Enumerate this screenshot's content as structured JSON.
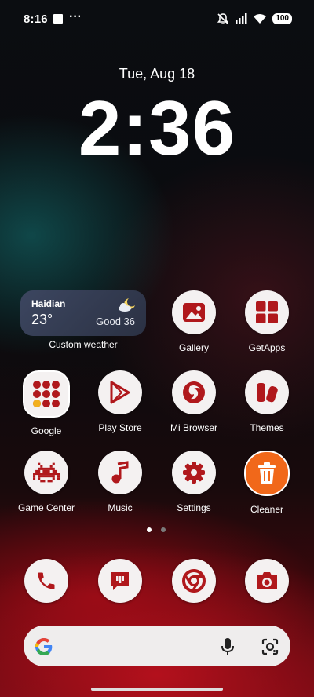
{
  "status_bar": {
    "time": "8:16",
    "dots": "···",
    "battery": "100"
  },
  "lock": {
    "date": "Tue, Aug 18",
    "time": "2:36"
  },
  "weather": {
    "city": "Haidian",
    "temperature": "23°",
    "air_quality": "Good 36",
    "label": "Custom weather"
  },
  "apps": {
    "gallery": "Gallery",
    "getapps": "GetApps",
    "google": "Google",
    "play_store": "Play Store",
    "mi_browser": "Mi Browser",
    "themes": "Themes",
    "game_center": "Game Center",
    "music": "Music",
    "settings": "Settings",
    "cleaner": "Cleaner"
  },
  "dock": [
    "phone-icon",
    "messages-icon",
    "chrome-icon",
    "camera-icon"
  ],
  "page_indicator": {
    "count": 2,
    "current": 1
  },
  "colors": {
    "accent_red": "#b0181c",
    "icon_bg": "#f4f1f1",
    "cleaner_orange": "#f1681a"
  }
}
